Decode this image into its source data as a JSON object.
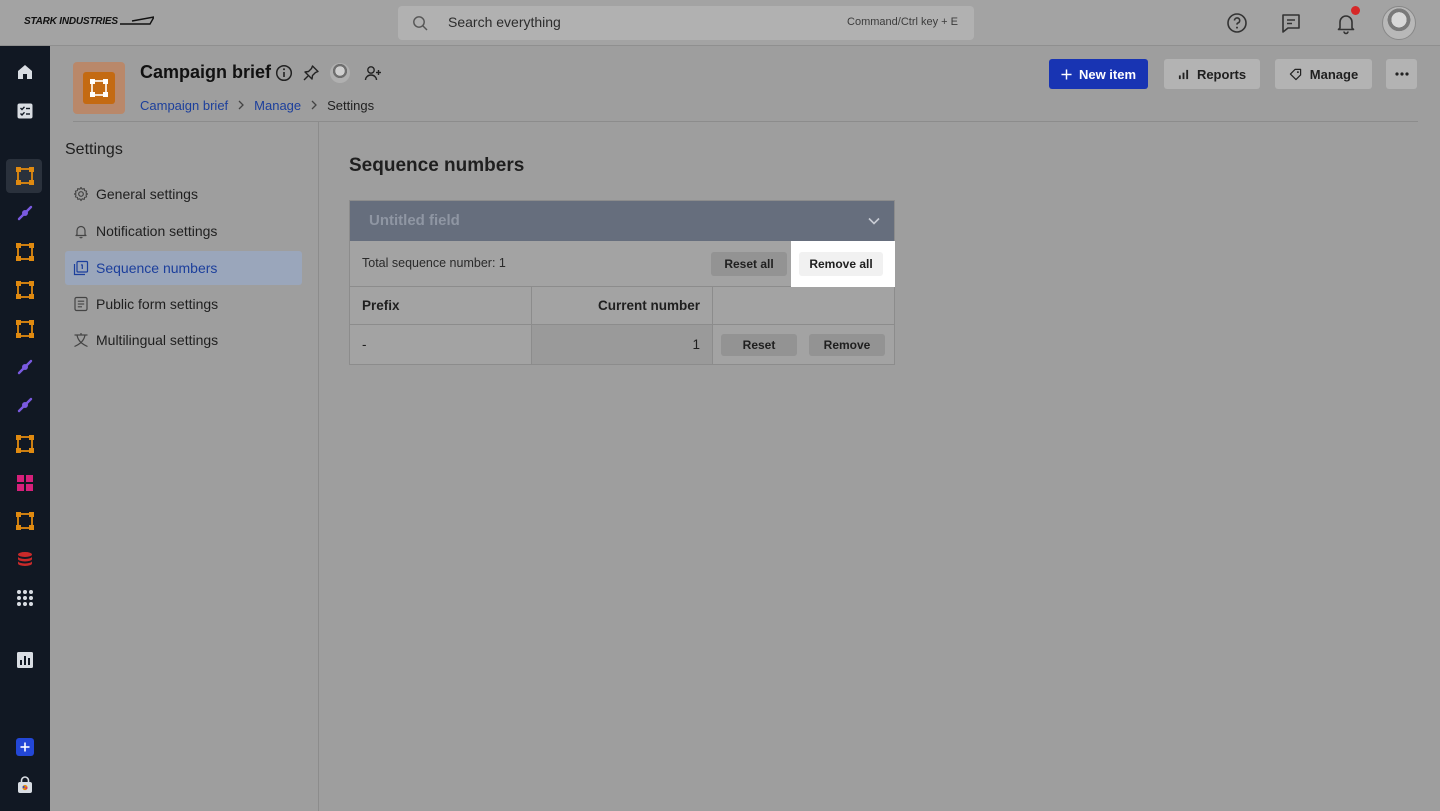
{
  "brand": {
    "logo_text": "STARK INDUSTRIES"
  },
  "search": {
    "placeholder": "Search everything",
    "shortcut_hint": "Command/Ctrl key + E"
  },
  "header": {
    "title": "Campaign brief",
    "breadcrumb": [
      "Campaign brief",
      "Manage",
      "Settings"
    ],
    "actions": {
      "new_item": "New item",
      "reports": "Reports",
      "manage": "Manage"
    }
  },
  "settings": {
    "title": "Settings",
    "items": [
      {
        "label": "General settings",
        "icon": "gear-icon"
      },
      {
        "label": "Notification settings",
        "icon": "bell-icon"
      },
      {
        "label": "Sequence numbers",
        "icon": "sequence-icon",
        "active": true
      },
      {
        "label": "Public form settings",
        "icon": "form-icon"
      },
      {
        "label": "Multilingual settings",
        "icon": "translate-icon"
      }
    ]
  },
  "main": {
    "title": "Sequence numbers",
    "field": {
      "name": "Untitled field",
      "total_text": "Total sequence number: 1",
      "reset_all": "Reset all",
      "remove_all": "Remove all",
      "columns": [
        "Prefix",
        "Current number",
        ""
      ],
      "rows": [
        {
          "prefix": "-",
          "current": "1",
          "reset": "Reset",
          "remove": "Remove"
        }
      ]
    }
  },
  "colors": {
    "accent": "#1834b3",
    "nav_bg": "#111823",
    "notification": "#d62828"
  }
}
